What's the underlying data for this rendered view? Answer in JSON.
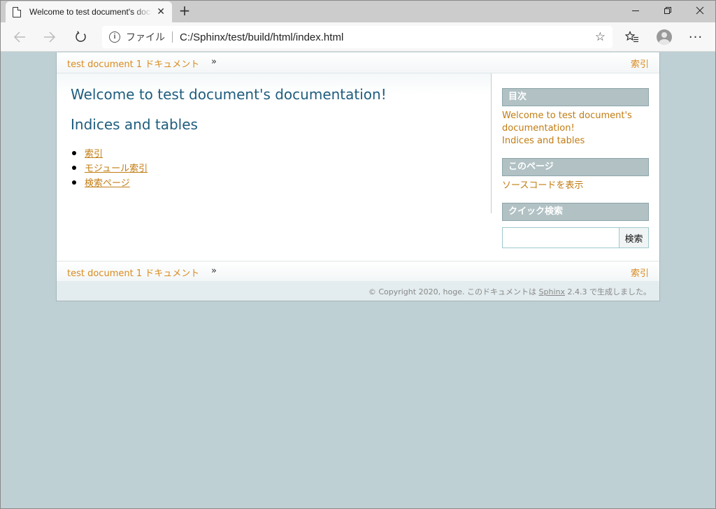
{
  "browser": {
    "tab_title": "Welcome to test document's documentation!",
    "new_tab": "+",
    "address": {
      "scheme_label": "ファイル",
      "url": "C:/Sphinx/test/build/html/index.html"
    },
    "icons": {
      "back": "arrow-left-icon",
      "forward": "arrow-right-icon",
      "refresh": "refresh-icon",
      "info": "info-icon",
      "favorite": "star-icon",
      "favorites": "favorites-list-icon",
      "profile": "avatar-icon",
      "more": "ellipsis-icon"
    }
  },
  "page": {
    "related_top": {
      "crumb": "test document 1 ドキュメント",
      "raquo": "»",
      "index": "索引"
    },
    "h1": "Welcome to test document's documentation!",
    "h2": "Indices and tables",
    "index_links": [
      "索引",
      "モジュール索引",
      "検索ページ"
    ],
    "sidebar": {
      "toc_title": "目次",
      "toc_items": [
        "Welcome to test document's",
        "documentation!",
        "Indices and tables"
      ],
      "this_page_title": "このページ",
      "show_source": "ソースコードを表示",
      "quick_search_title": "クイック検索",
      "search_button": "検索",
      "search_value": ""
    },
    "related_bottom": {
      "crumb": "test document 1 ドキュメント",
      "raquo": "»",
      "index": "索引"
    },
    "footer": {
      "prefix": "© Copyright 2020, hoge. このドキュメントは",
      "link": "Sphinx",
      "suffix": "2.4.3 で生成しました。"
    }
  },
  "colors": {
    "page_bg": "#bfd0d4",
    "link": "#c17c12",
    "heading": "#1e5d7e",
    "sidebar_head": "#b1c1c4"
  }
}
